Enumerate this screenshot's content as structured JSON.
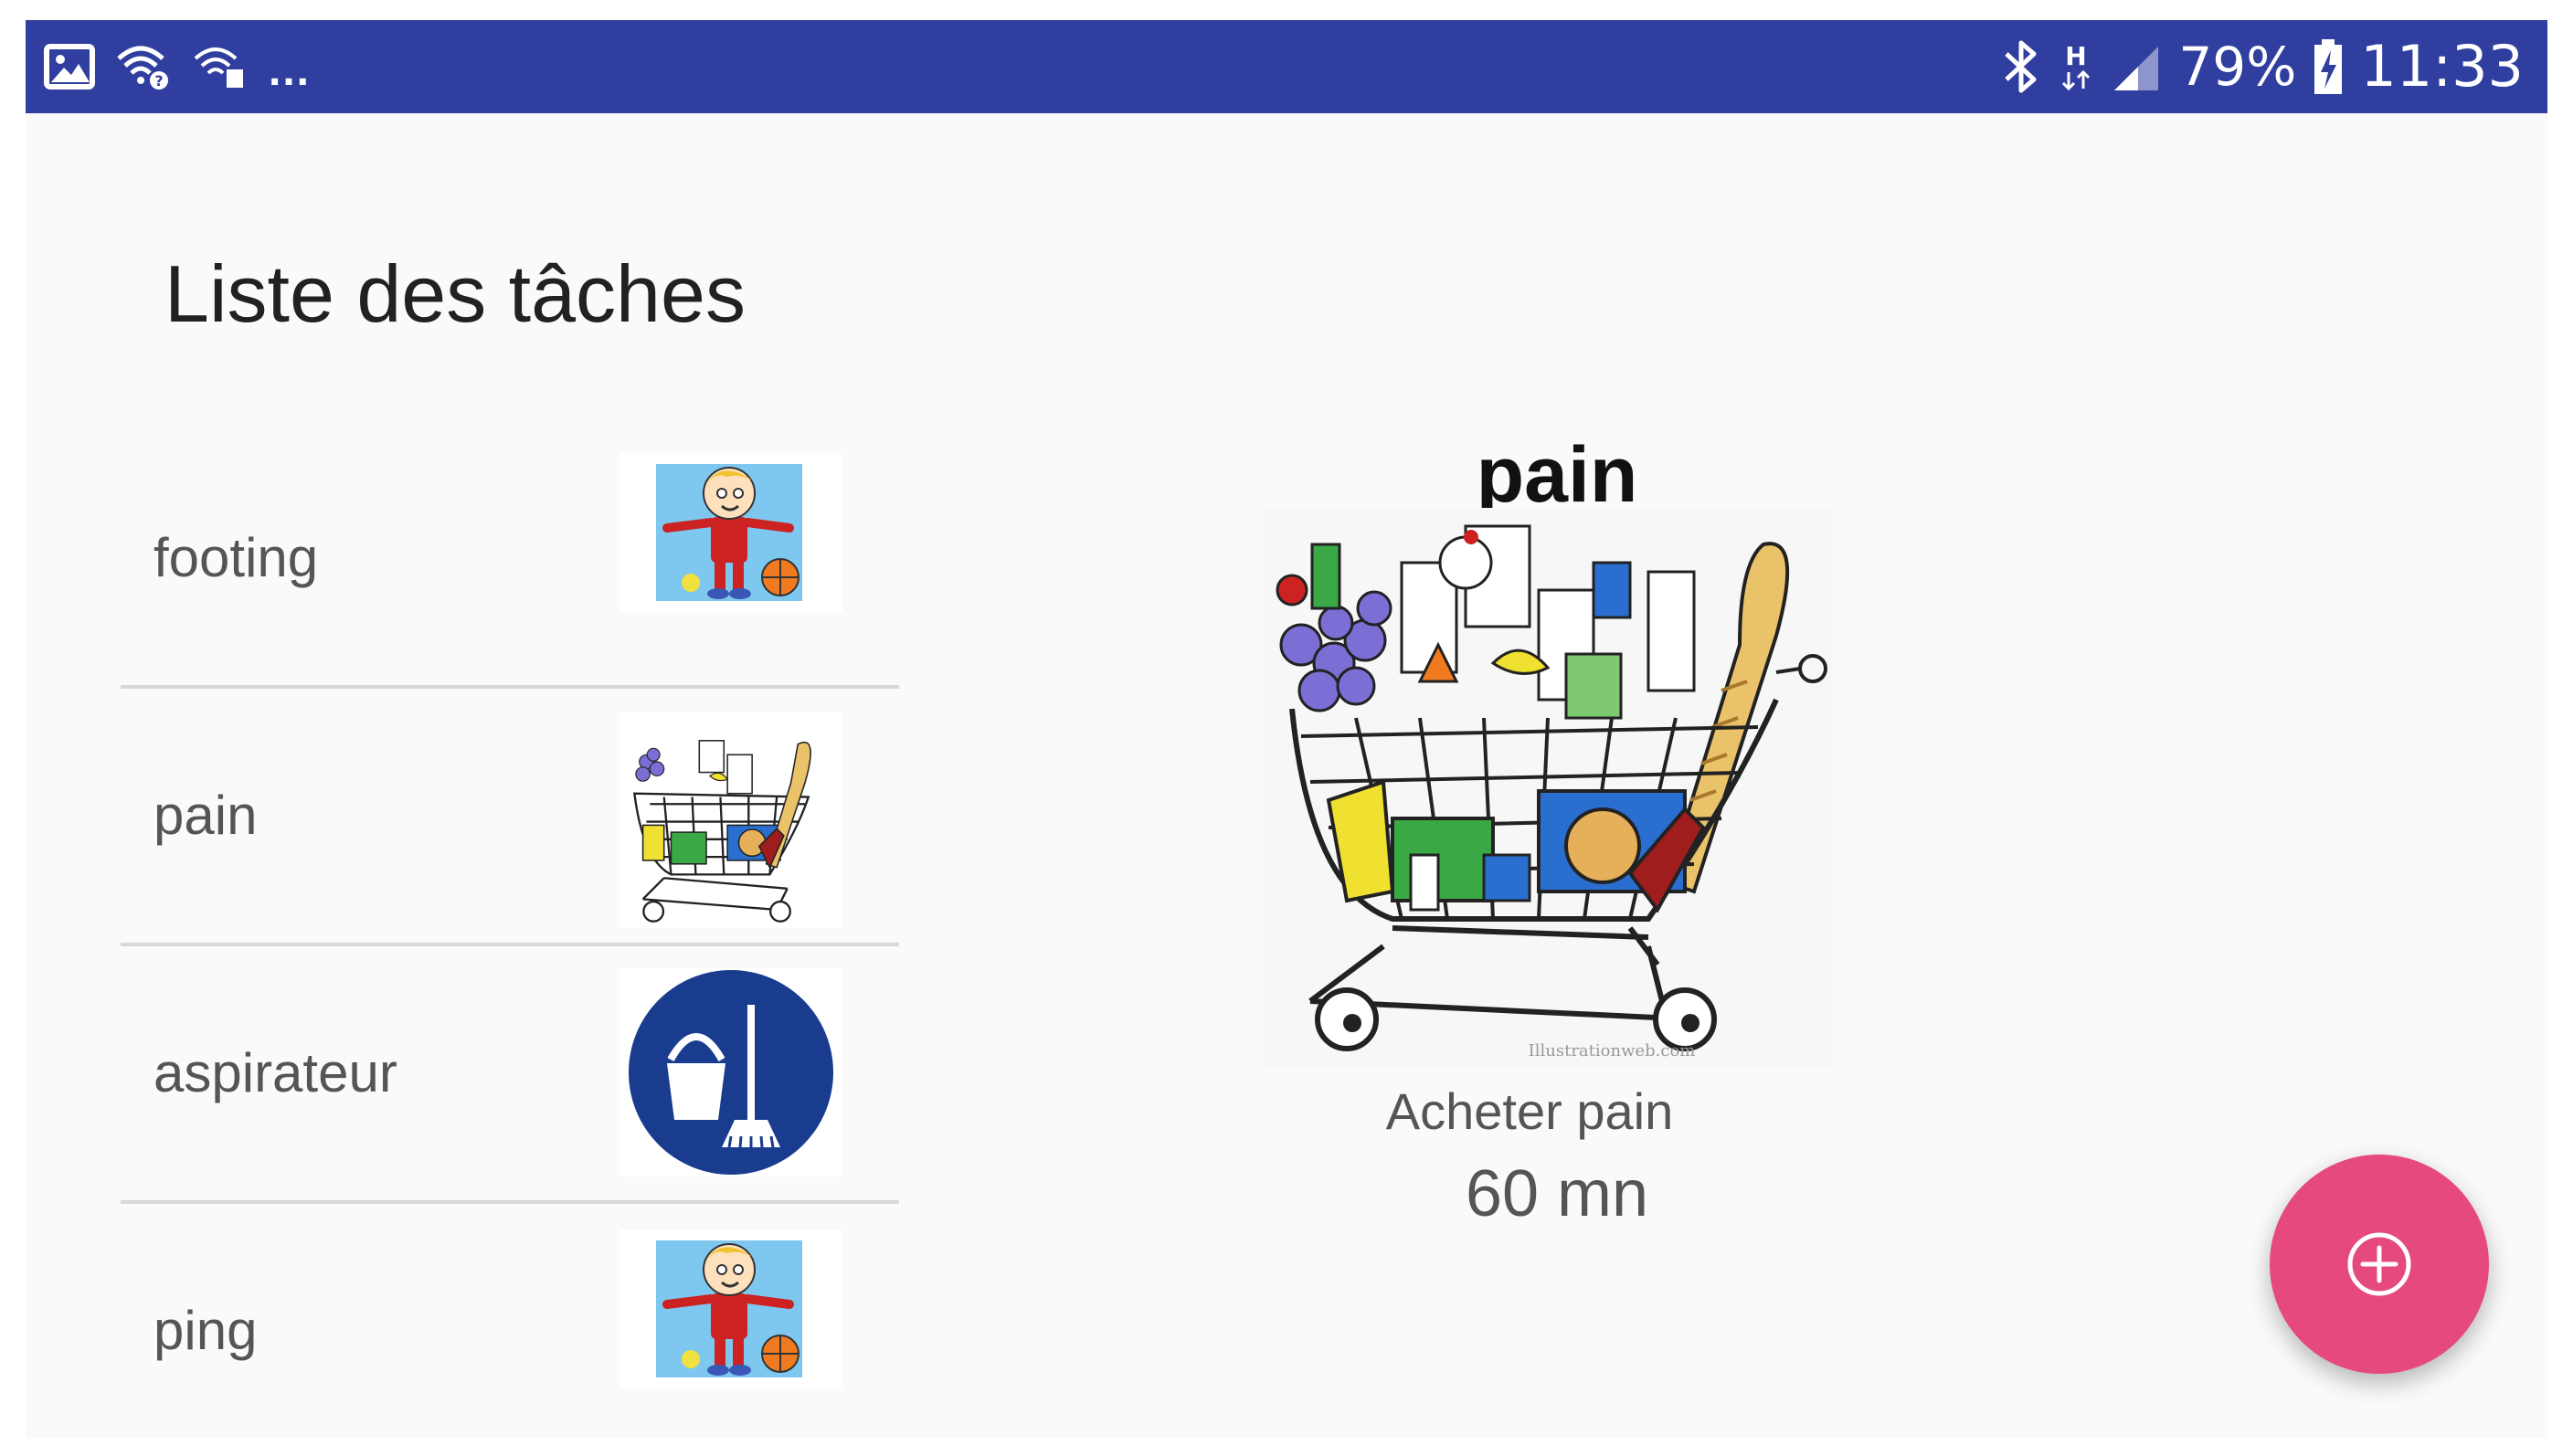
{
  "status_bar": {
    "left_icons": [
      "image-icon",
      "wifi-question-icon",
      "wifi-data-icon"
    ],
    "overflow": "...",
    "right_icons": [
      "bluetooth-icon",
      "h-data-icon",
      "signal-icon"
    ],
    "battery_percent": "79%",
    "battery_icon": "battery-charging-icon",
    "time": "11:33"
  },
  "page": {
    "title": "Liste des tâches"
  },
  "tasks": [
    {
      "label": "footing",
      "thumbnail": "child-cartoon-image"
    },
    {
      "label": "pain",
      "thumbnail": "shopping-cart-image"
    },
    {
      "label": "aspirateur",
      "thumbnail": "cleaning-bucket-broom-icon"
    },
    {
      "label": "ping",
      "thumbnail": "child-cartoon-image"
    }
  ],
  "detail": {
    "title": "pain",
    "image": "shopping-cart-image",
    "watermark": "Illustrationweb.com",
    "description": "Acheter pain",
    "duration": "60 mn"
  },
  "fab": {
    "icon": "add-circle-icon"
  },
  "colors": {
    "status_bar": "#303f9f",
    "background": "#fafafa",
    "fab": "#e64980",
    "cleaning_icon": "#1a3c8f"
  }
}
